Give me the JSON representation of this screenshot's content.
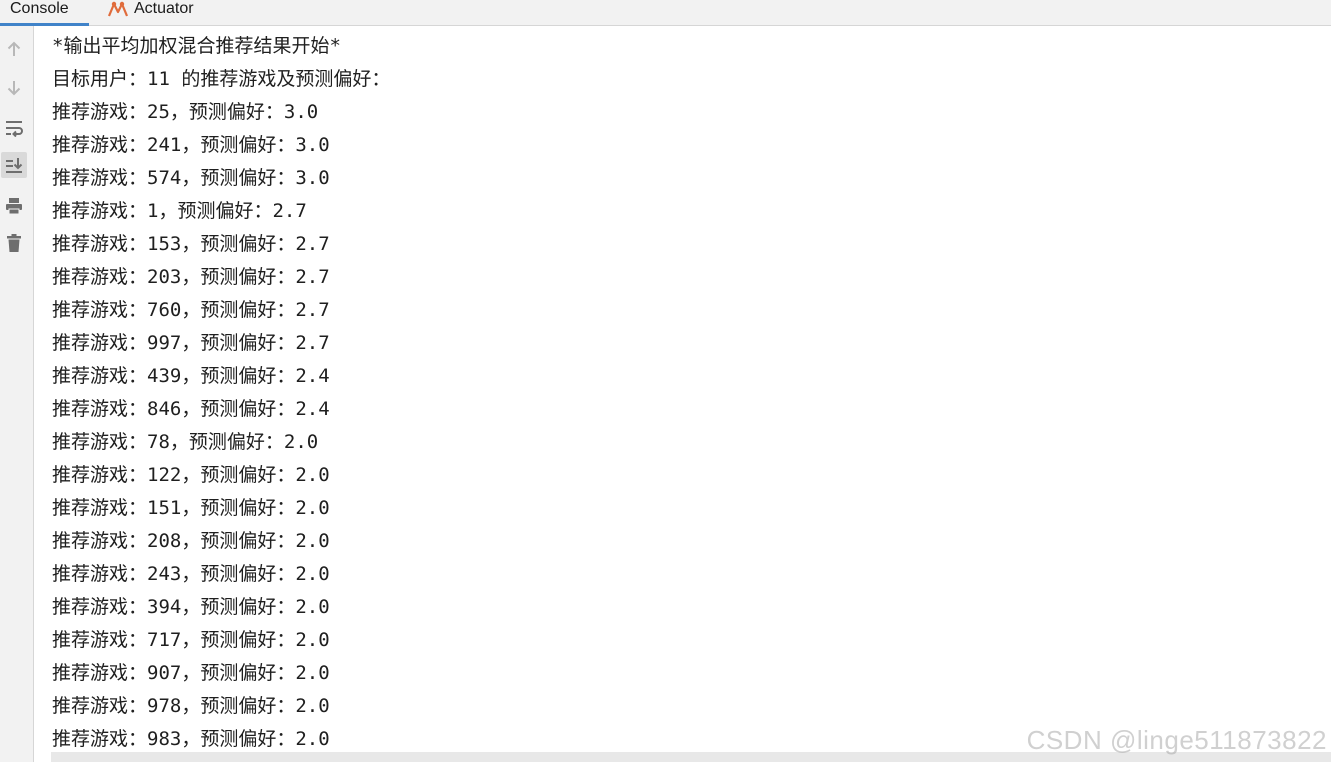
{
  "tabs": [
    {
      "label": "Console",
      "active": true
    },
    {
      "label": "Actuator",
      "active": false,
      "icon": "actuator-icon"
    }
  ],
  "toolbar": {
    "icons": [
      "up-arrow-icon",
      "down-arrow-icon",
      "soft-wrap-icon",
      "scroll-to-end-icon",
      "print-icon",
      "trash-icon"
    ],
    "active_icon": "scroll-to-end-icon"
  },
  "console": {
    "lines": [
      "*输出平均加权混合推荐结果开始*",
      "目标用户：11 的推荐游戏及预测偏好：",
      "推荐游戏：25，预测偏好：3.0",
      "推荐游戏：241，预测偏好：3.0",
      "推荐游戏：574，预测偏好：3.0",
      "推荐游戏：1，预测偏好：2.7",
      "推荐游戏：153，预测偏好：2.7",
      "推荐游戏：203，预测偏好：2.7",
      "推荐游戏：760，预测偏好：2.7",
      "推荐游戏：997，预测偏好：2.7",
      "推荐游戏：439，预测偏好：2.4",
      "推荐游戏：846，预测偏好：2.4",
      "推荐游戏：78，预测偏好：2.0",
      "推荐游戏：122，预测偏好：2.0",
      "推荐游戏：151，预测偏好：2.0",
      "推荐游戏：208，预测偏好：2.0",
      "推荐游戏：243，预测偏好：2.0",
      "推荐游戏：394，预测偏好：2.0",
      "推荐游戏：717，预测偏好：2.0",
      "推荐游戏：907，预测偏好：2.0",
      "推荐游戏：978，预测偏好：2.0",
      "推荐游戏：983，预测偏好：2.0"
    ]
  },
  "watermark": "CSDN @linge511873822",
  "colors": {
    "tab_underline": "#4083c9",
    "actuator_icon": "#e06c3c",
    "gutter_bg": "#f2f2f2",
    "icon_gray": "#6e6e6e",
    "text": "#1f1f1f"
  }
}
